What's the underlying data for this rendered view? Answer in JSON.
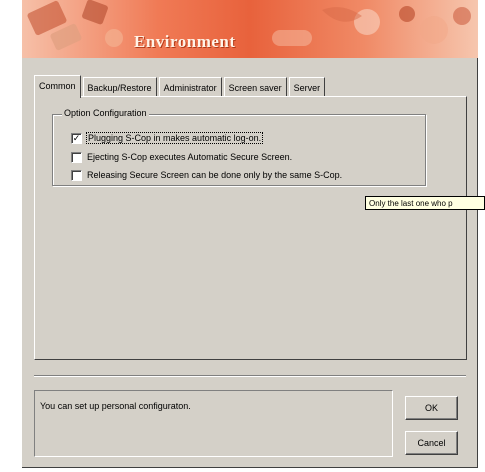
{
  "window": {
    "title": "Environment"
  },
  "tabs": [
    {
      "label": "Common",
      "active": true
    },
    {
      "label": "Backup/Restore",
      "active": false
    },
    {
      "label": "Administrator",
      "active": false
    },
    {
      "label": "Screen saver",
      "active": false
    },
    {
      "label": "Server",
      "active": false
    }
  ],
  "option_group": {
    "legend": "Option Configuration",
    "options": [
      {
        "label": "Plugging S-Cop in makes automatic log-on.",
        "checked": true,
        "check_glyph": "✓"
      },
      {
        "label": "Ejecting S-Cop executes Automatic Secure Screen.",
        "checked": false,
        "check_glyph": ""
      },
      {
        "label": "Releasing Secure Screen can be done only by the same S-Cop.",
        "checked": false,
        "check_glyph": ""
      }
    ]
  },
  "tooltip": {
    "text": "Only the last one who p"
  },
  "status": {
    "text": "You can set up personal configuraton."
  },
  "buttons": {
    "ok": "OK",
    "cancel": "Cancel"
  },
  "colors": {
    "dialog_face": "#d4d0c8",
    "banner_accent": "#e8623c",
    "tooltip_bg": "#ffffe1"
  }
}
